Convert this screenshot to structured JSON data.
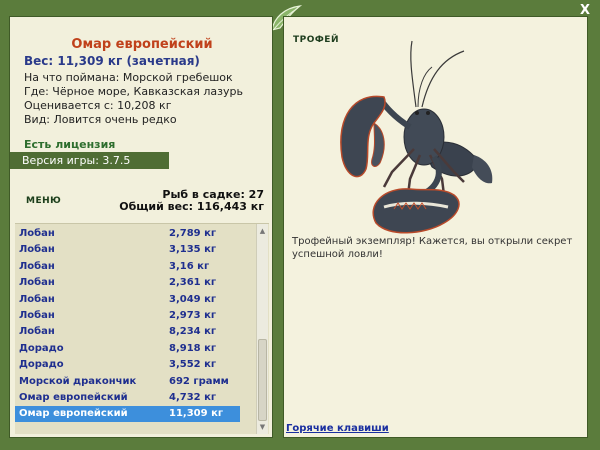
{
  "window": {
    "close_label": "X"
  },
  "fish": {
    "name": "Омар европейский",
    "weight_line": "Вес: 11,309 кг (зачетная)",
    "bait_line": "На что поймана: Морской гребешок",
    "location_line": "Где: Чёрное море, Кавказская лазурь",
    "value_line": "Оценивается с: 10,208 кг",
    "type_line": "Вид: Ловится очень редко"
  },
  "license_label": "Есть лицензия",
  "version_label": "Версия игры: 3.7.5",
  "menu_label": "МЕНЮ",
  "stats": {
    "count_line": "Рыб в садке: 27",
    "total_line": "Общий вес: 116,443 кг"
  },
  "catch_list": [
    {
      "name": "Лобан",
      "weight": "2,789 кг"
    },
    {
      "name": "Лобан",
      "weight": "3,135 кг"
    },
    {
      "name": "Лобан",
      "weight": "3,16 кг"
    },
    {
      "name": "Лобан",
      "weight": "2,361 кг"
    },
    {
      "name": "Лобан",
      "weight": "3,049 кг"
    },
    {
      "name": "Лобан",
      "weight": "2,973 кг"
    },
    {
      "name": "Лобан",
      "weight": "8,234 кг"
    },
    {
      "name": "Дорадо",
      "weight": "8,918 кг"
    },
    {
      "name": "Дорадо",
      "weight": "3,552 кг"
    },
    {
      "name": "Морской дракончик",
      "weight": "692 грамм"
    },
    {
      "name": "Омар европейский",
      "weight": "4,732 кг"
    },
    {
      "name": "Омар европейский",
      "weight": "11,309 кг",
      "selected": true
    }
  ],
  "trophy": {
    "label": "ТРОФЕЙ",
    "message": "Трофейный экземпляр! Кажется, вы открыли секрет успешной ловли!"
  },
  "hotkeys_label": "Горячие клавиши",
  "colors": {
    "frame": "#5b7c3c",
    "panel": "#f2f0dc",
    "fish_name": "#c0411b",
    "list_text": "#1f2f8f",
    "selected_row": "#3d8fdc"
  }
}
